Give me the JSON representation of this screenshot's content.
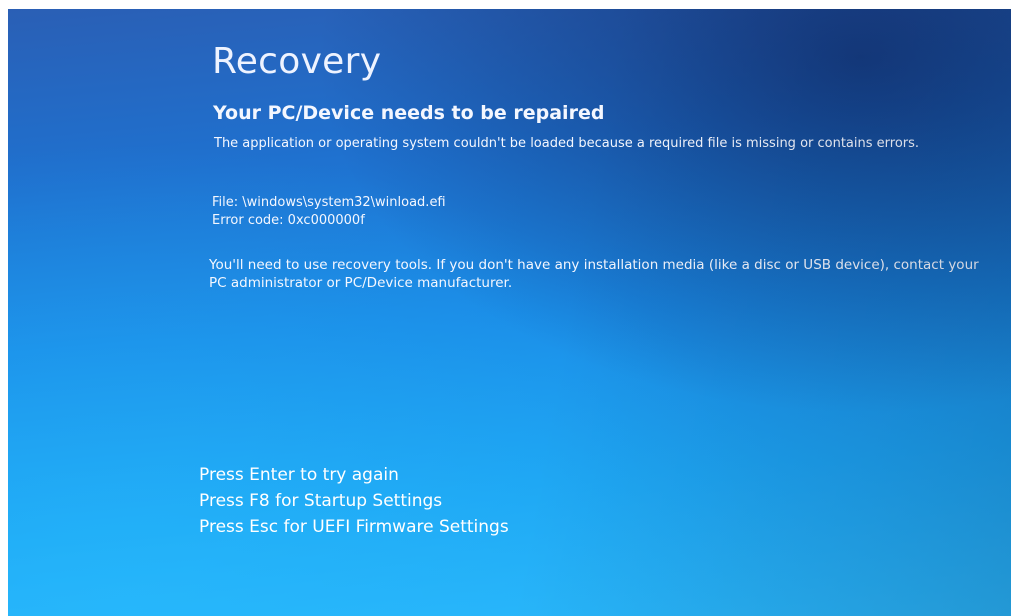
{
  "recovery": {
    "title": "Recovery",
    "subtitle": "Your PC/Device needs to be repaired",
    "message": "The application or operating system couldn't be loaded because a required file is missing or contains errors.",
    "file_line": "File: \\windows\\system32\\winload.efi",
    "error_code_line": "Error code: 0xc000000f",
    "instructions": "You'll need to use recovery tools. If you don't have any installation media (like a disc or USB device), contact your PC administrator or PC/Device manufacturer.",
    "actions": [
      "Press Enter to try again",
      "Press F8 for Startup Settings",
      "Press Esc for UEFI Firmware Settings"
    ]
  },
  "colors": {
    "background_top": "#2a5fb5",
    "background_bottom": "#2bb8fb",
    "text": "#ffffff"
  }
}
